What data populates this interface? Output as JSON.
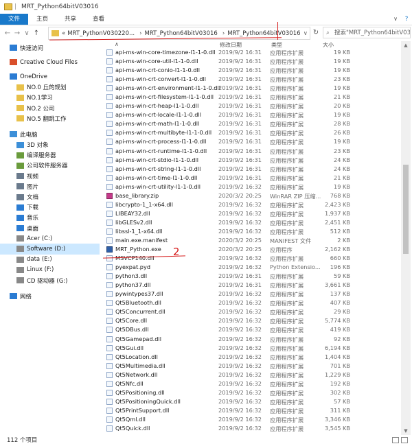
{
  "window": {
    "title": "MRT_Python64bitV03016",
    "title_sep": "|"
  },
  "ribbon": {
    "tabs": [
      "文件",
      "主页",
      "共享",
      "查看"
    ],
    "expand_glyph": "∨",
    "help_glyph": "?"
  },
  "address": {
    "crumbs": [
      "MRT_PythonV030220...",
      "MRT_Python64bitV03016",
      "MRT_Python64bitV03016"
    ],
    "crumb_lead": "«",
    "search_placeholder": "搜索\"MRT_Python64bitV03016\""
  },
  "columns": {
    "date": "修改日期",
    "type": "类型",
    "size": "大小"
  },
  "sidebar": [
    {
      "label": "快速访问",
      "icon": "star-icon",
      "color": "#2b7cd3"
    },
    {
      "label": "Creative Cloud Files",
      "icon": "cloud-icon",
      "color": "#d94f2b"
    },
    {
      "label": "OneDrive",
      "icon": "cloud-icon",
      "color": "#2b7cd3"
    },
    {
      "label": "NO.0 丘的规划",
      "icon": "folder-icon",
      "color": "#e8c14a"
    },
    {
      "label": "NO.1学习",
      "icon": "folder-icon",
      "color": "#e8c14a"
    },
    {
      "label": "NO.2 公司",
      "icon": "folder-icon",
      "color": "#e8c14a"
    },
    {
      "label": "NO.5 翻跳工作",
      "icon": "folder-icon",
      "color": "#e8c14a"
    },
    {
      "label": "此电脑",
      "icon": "computer-icon",
      "color": "#3c8fd8"
    },
    {
      "label": "3D 对象",
      "icon": "cube-icon",
      "color": "#3c8fd8"
    },
    {
      "label": "编译服务器",
      "icon": "drive-icon",
      "color": "#6a9b3c"
    },
    {
      "label": "公司软件服务器",
      "icon": "drive-icon",
      "color": "#6a9b3c"
    },
    {
      "label": "视频",
      "icon": "video-icon",
      "color": "#6a7a8c"
    },
    {
      "label": "图片",
      "icon": "picture-icon",
      "color": "#6a7a8c"
    },
    {
      "label": "文档",
      "icon": "document-icon",
      "color": "#6a7a8c"
    },
    {
      "label": "下载",
      "icon": "download-icon",
      "color": "#2b7cd3"
    },
    {
      "label": "音乐",
      "icon": "music-icon",
      "color": "#2b7cd3"
    },
    {
      "label": "桌面",
      "icon": "desktop-icon",
      "color": "#2b7cd3"
    },
    {
      "label": "Acer (C:)",
      "icon": "drive-icon",
      "color": "#888"
    },
    {
      "label": "Software (D:)",
      "icon": "drive-icon",
      "color": "#888",
      "selected": true
    },
    {
      "label": "data (E:)",
      "icon": "drive-icon",
      "color": "#888"
    },
    {
      "label": "Linux (F:)",
      "icon": "drive-icon",
      "color": "#888"
    },
    {
      "label": "CD 驱动器 (G:)",
      "icon": "disc-icon",
      "color": "#888"
    },
    {
      "label": "网络",
      "icon": "network-icon",
      "color": "#2b7cd3"
    }
  ],
  "files": [
    {
      "name": "api-ms-win-core-timezone-l1-1-0.dll",
      "date": "2019/9/2 16:31",
      "type": "应用程序扩展",
      "size": "19 KB"
    },
    {
      "name": "api-ms-win-core-util-l1-1-0.dll",
      "date": "2019/9/2 16:31",
      "type": "应用程序扩展",
      "size": "19 KB"
    },
    {
      "name": "api-ms-win-crt-conio-l1-1-0.dll",
      "date": "2019/9/2 16:31",
      "type": "应用程序扩展",
      "size": "19 KB"
    },
    {
      "name": "api-ms-win-crt-convert-l1-1-0.dll",
      "date": "2019/9/2 16:31",
      "type": "应用程序扩展",
      "size": "23 KB"
    },
    {
      "name": "api-ms-win-crt-environment-l1-1-0.dll",
      "date": "2019/9/2 16:31",
      "type": "应用程序扩展",
      "size": "19 KB"
    },
    {
      "name": "api-ms-win-crt-filesystem-l1-1-0.dll",
      "date": "2019/9/2 16:31",
      "type": "应用程序扩展",
      "size": "21 KB"
    },
    {
      "name": "api-ms-win-crt-heap-l1-1-0.dll",
      "date": "2019/9/2 16:31",
      "type": "应用程序扩展",
      "size": "20 KB"
    },
    {
      "name": "api-ms-win-crt-locale-l1-1-0.dll",
      "date": "2019/9/2 16:31",
      "type": "应用程序扩展",
      "size": "19 KB"
    },
    {
      "name": "api-ms-win-crt-math-l1-1-0.dll",
      "date": "2019/9/2 16:31",
      "type": "应用程序扩展",
      "size": "28 KB"
    },
    {
      "name": "api-ms-win-crt-multibyte-l1-1-0.dll",
      "date": "2019/9/2 16:31",
      "type": "应用程序扩展",
      "size": "26 KB"
    },
    {
      "name": "api-ms-win-crt-process-l1-1-0.dll",
      "date": "2019/9/2 16:31",
      "type": "应用程序扩展",
      "size": "19 KB"
    },
    {
      "name": "api-ms-win-crt-runtime-l1-1-0.dll",
      "date": "2019/9/2 16:31",
      "type": "应用程序扩展",
      "size": "23 KB"
    },
    {
      "name": "api-ms-win-crt-stdio-l1-1-0.dll",
      "date": "2019/9/2 16:31",
      "type": "应用程序扩展",
      "size": "24 KB"
    },
    {
      "name": "api-ms-win-crt-string-l1-1-0.dll",
      "date": "2019/9/2 16:31",
      "type": "应用程序扩展",
      "size": "24 KB"
    },
    {
      "name": "api-ms-win-crt-time-l1-1-0.dll",
      "date": "2019/9/2 16:31",
      "type": "应用程序扩展",
      "size": "21 KB"
    },
    {
      "name": "api-ms-win-crt-utility-l1-1-0.dll",
      "date": "2019/9/2 16:32",
      "type": "应用程序扩展",
      "size": "19 KB"
    },
    {
      "name": "base_library.zip",
      "date": "2020/3/2 20:25",
      "type": "WinRAR ZIP 压缩...",
      "size": "768 KB"
    },
    {
      "name": "libcrypto-1_1-x64.dll",
      "date": "2019/9/2 16:32",
      "type": "应用程序扩展",
      "size": "2,423 KB"
    },
    {
      "name": "LIBEAY32.dll",
      "date": "2019/9/2 16:32",
      "type": "应用程序扩展",
      "size": "1,937 KB"
    },
    {
      "name": "libGLESv2.dll",
      "date": "2019/9/2 16:32",
      "type": "应用程序扩展",
      "size": "2,451 KB"
    },
    {
      "name": "libssl-1_1-x64.dll",
      "date": "2019/9/2 16:32",
      "type": "应用程序扩展",
      "size": "512 KB"
    },
    {
      "name": "main.exe.manifest",
      "date": "2020/3/2 20:25",
      "type": "MANIFEST 文件",
      "size": "2 KB"
    },
    {
      "name": "MRT_Python.exe",
      "date": "2020/3/2 20:25",
      "type": "应用程序",
      "size": "2,162 KB"
    },
    {
      "name": "MSVCP140.dll",
      "date": "2019/9/2 16:32",
      "type": "应用程序扩展",
      "size": "660 KB"
    },
    {
      "name": "pyexpat.pyd",
      "date": "2019/9/2 16:32",
      "type": "Python Extensio...",
      "size": "196 KB"
    },
    {
      "name": "python3.dll",
      "date": "2019/9/2 16:31",
      "type": "应用程序扩展",
      "size": "59 KB"
    },
    {
      "name": "python37.dll",
      "date": "2019/9/2 16:31",
      "type": "应用程序扩展",
      "size": "3,661 KB"
    },
    {
      "name": "pywintypes37.dll",
      "date": "2019/9/2 16:32",
      "type": "应用程序扩展",
      "size": "137 KB"
    },
    {
      "name": "Qt5Bluetooth.dll",
      "date": "2019/9/2 16:32",
      "type": "应用程序扩展",
      "size": "407 KB"
    },
    {
      "name": "Qt5Concurrent.dll",
      "date": "2019/9/2 16:32",
      "type": "应用程序扩展",
      "size": "29 KB"
    },
    {
      "name": "Qt5Core.dll",
      "date": "2019/9/2 16:32",
      "type": "应用程序扩展",
      "size": "5,774 KB"
    },
    {
      "name": "Qt5DBus.dll",
      "date": "2019/9/2 16:32",
      "type": "应用程序扩展",
      "size": "419 KB"
    },
    {
      "name": "Qt5Gamepad.dll",
      "date": "2019/9/2 16:32",
      "type": "应用程序扩展",
      "size": "92 KB"
    },
    {
      "name": "Qt5Gui.dll",
      "date": "2019/9/2 16:32",
      "type": "应用程序扩展",
      "size": "6,194 KB"
    },
    {
      "name": "Qt5Location.dll",
      "date": "2019/9/2 16:32",
      "type": "应用程序扩展",
      "size": "1,404 KB"
    },
    {
      "name": "Qt5Multimedia.dll",
      "date": "2019/9/2 16:32",
      "type": "应用程序扩展",
      "size": "701 KB"
    },
    {
      "name": "Qt5Network.dll",
      "date": "2019/9/2 16:32",
      "type": "应用程序扩展",
      "size": "1,229 KB"
    },
    {
      "name": "Qt5Nfc.dll",
      "date": "2019/9/2 16:32",
      "type": "应用程序扩展",
      "size": "192 KB"
    },
    {
      "name": "Qt5Positioning.dll",
      "date": "2019/9/2 16:32",
      "type": "应用程序扩展",
      "size": "302 KB"
    },
    {
      "name": "Qt5PositioningQuick.dll",
      "date": "2019/9/2 16:32",
      "type": "应用程序扩展",
      "size": "57 KB"
    },
    {
      "name": "Qt5PrintSupport.dll",
      "date": "2019/9/2 16:32",
      "type": "应用程序扩展",
      "size": "311 KB"
    },
    {
      "name": "Qt5Qml.dll",
      "date": "2019/9/2 16:32",
      "type": "应用程序扩展",
      "size": "3,346 KB"
    },
    {
      "name": "Qt5Quick.dll",
      "date": "2019/9/2 16:32",
      "type": "应用程序扩展",
      "size": "3,545 KB"
    }
  ],
  "annotation": {
    "mark": "2"
  },
  "status": {
    "count_text": "112 个项目"
  }
}
